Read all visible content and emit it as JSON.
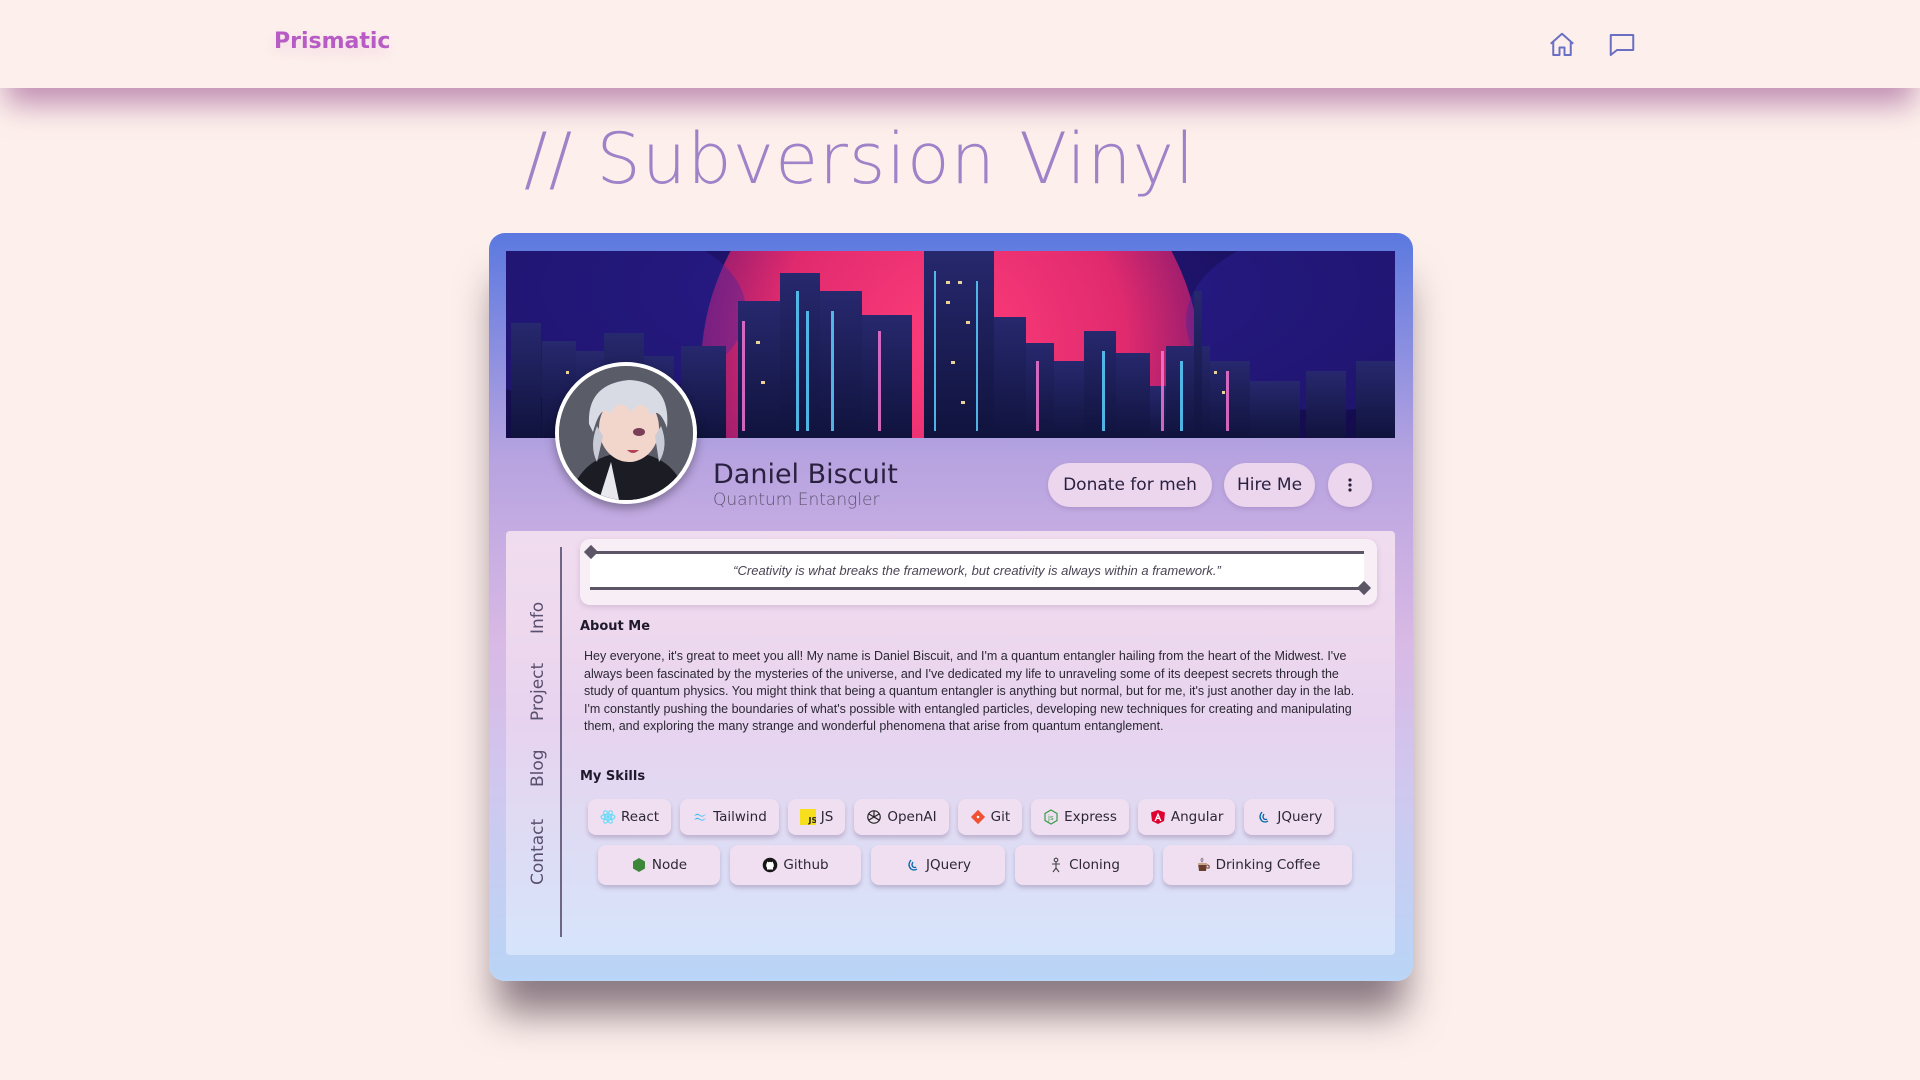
{
  "header": {
    "brand": "Prismatic",
    "icons": [
      "home-icon",
      "chat-icon"
    ]
  },
  "page": {
    "title": "// Subversion Vinyl"
  },
  "profile": {
    "name": "Daniel Biscuit",
    "role": "Quantum Entangler",
    "actions": {
      "donate_label": "Donate for meh",
      "hire_label": "Hire Me",
      "more_icon": "kebab-menu-icon"
    }
  },
  "side_nav": {
    "tabs": [
      "Info",
      "Project",
      "Blog",
      "Contact"
    ]
  },
  "quote": "“Creativity is what breaks the framework, but creativity is always within a framework.”",
  "about": {
    "heading": "About Me",
    "text": "Hey everyone, it's great to meet you all! My name is Daniel Biscuit, and I'm a quantum entangler hailing from the heart of the Midwest. I've always been fascinated by the mysteries of the universe, and I've dedicated my life to unraveling some of its deepest secrets through the study of quantum physics. You might think that being a quantum entangler is anything but normal, but for me, it's just another day in the lab. I'm constantly pushing the boundaries of what's possible with entangled particles, developing new techniques for creating and manipulating them, and exploring the many strange and wonderful phenomena that arise from quantum entanglement."
  },
  "skills": {
    "heading": "My Skills",
    "row1": [
      {
        "label": "React",
        "icon": "react-icon"
      },
      {
        "label": "Tailwind",
        "icon": "tailwind-icon"
      },
      {
        "label": "JS",
        "icon": "js-icon"
      },
      {
        "label": "OpenAI",
        "icon": "openai-icon"
      },
      {
        "label": "Git",
        "icon": "git-icon"
      },
      {
        "label": "Express",
        "icon": "express-icon"
      },
      {
        "label": "Angular",
        "icon": "angular-icon"
      },
      {
        "label": "JQuery",
        "icon": "jquery-icon"
      }
    ],
    "row2": [
      {
        "label": "Node",
        "icon": "node-icon"
      },
      {
        "label": "Github",
        "icon": "github-icon"
      },
      {
        "label": "JQuery",
        "icon": "jquery-icon"
      },
      {
        "label": "Cloning",
        "icon": "cloning-icon"
      },
      {
        "label": "Drinking Coffee",
        "icon": "coffee-icon"
      }
    ]
  },
  "colors": {
    "background": "#fdf0ec",
    "brand": "#b65cc4",
    "title": "#9a7dc7",
    "nav_icon": "#6b6fc4"
  }
}
